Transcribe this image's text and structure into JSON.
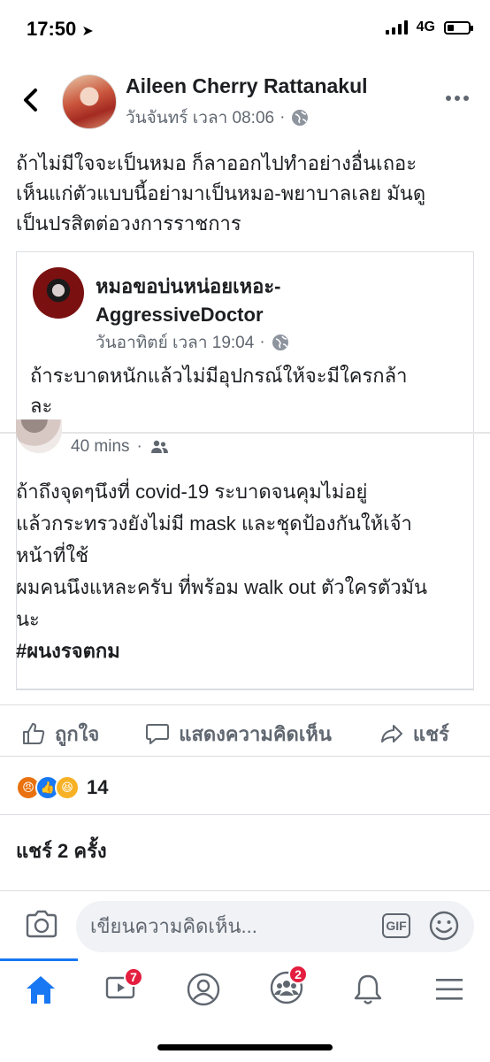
{
  "status_bar": {
    "time": "17:50",
    "network": "4G"
  },
  "post": {
    "author": "Aileen Cherry Rattanakul",
    "time": "วันจันทร์ เวลา 08:06",
    "text_lines": [
      "ถ้าไม่มีใจจะเป็นหมอ ก็ลาออกไปทำอย่างอื่นเถอะ",
      "เห็นแก่ตัวแบบนี้อย่ามาเป็นหมอ-พยาบาลเลย มันดู",
      "เป็นปรสิตต่อวงการราชการ"
    ]
  },
  "shared": {
    "page_name_lines": [
      "หมอขอบ่นหน่อยเหอะ-",
      "AggressiveDoctor"
    ],
    "time": "วันอาทิตย์ เวลา 19:04",
    "text_lines": [
      "ถ้าระบาดหนักแล้วไม่มีอุปกรณ์ให้จะมีใครกล้า",
      "ละ"
    ],
    "inner_time": "40 mins",
    "inner_lines": [
      "ถ้าถึงจุดๆนึงที่ covid-19 ระบาดจนคุมไม่อยู่",
      "แล้วกระทรวงยังไม่มี mask และชุดป้องกันให้เจ้า",
      "หน้าที่ใช้",
      "ผมคนนึงแหละครับ ที่พร้อม walk out ตัวใครตัวมัน",
      "นะ"
    ],
    "hashtag": "#ผนงรจตกม"
  },
  "actions": {
    "like": "ถูกใจ",
    "comment": "แสดงความคิดเห็น",
    "share": "แชร์"
  },
  "reactions": {
    "count": "14",
    "types": [
      "angry",
      "like",
      "haha"
    ]
  },
  "shares": "แชร์ 2 ครั้ง",
  "comment_box": {
    "placeholder": "เขียนความคิดเห็น...",
    "gif": "GIF"
  },
  "tabs": {
    "watch_badge": "7",
    "groups_badge": "2"
  },
  "colors": {
    "accent": "#1877f2",
    "badge": "#e41e3f",
    "muted": "#606770"
  }
}
